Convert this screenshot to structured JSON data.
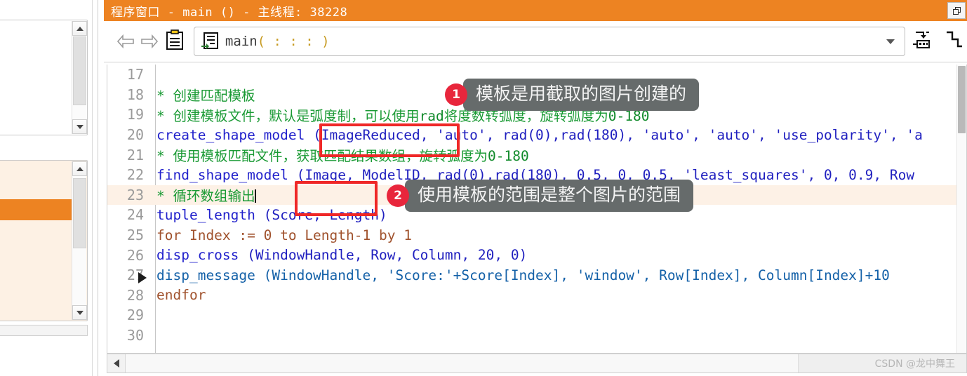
{
  "window": {
    "title": "程序窗口 - main () - 主线程: 38228",
    "restore_label": "restore-window"
  },
  "toolbar": {
    "back_label": "back",
    "forward_label": "forward",
    "clipboard_label": "clipboard",
    "procedure_name": "main",
    "procedure_params": "( : : : )",
    "dropdown_label": "procedure-selector",
    "icon1_label": "insert-breakpoint",
    "icon2_label": "step-over"
  },
  "editor": {
    "lines": [
      {
        "num": "17",
        "highlight": false,
        "segments": []
      },
      {
        "num": "18",
        "highlight": false,
        "segments": [
          {
            "cls": "cm",
            "text": "* 创建匹配模板"
          }
        ]
      },
      {
        "num": "19",
        "highlight": false,
        "segments": [
          {
            "cls": "cm",
            "text": "* 创建模板文件，默认是弧度制，可以使用"
          },
          {
            "cls": "cm2",
            "text": "rad"
          },
          {
            "cls": "cm",
            "text": "将度数转弧度，旋转弧度为"
          },
          {
            "cls": "cm2",
            "text": "0-180"
          }
        ]
      },
      {
        "num": "20",
        "highlight": false,
        "segments": [
          {
            "cls": "fn",
            "text": "create_shape_model"
          },
          {
            "cls": "pn",
            "text": " (ImageReduced, 'auto', rad(0),rad(180), 'auto', 'auto', 'use_polarity', 'a"
          }
        ]
      },
      {
        "num": "21",
        "highlight": false,
        "segments": [
          {
            "cls": "cm",
            "text": "* 使用模板匹配文件，获取匹配结果数组，旋转弧度为"
          },
          {
            "cls": "cm2",
            "text": "0-180"
          }
        ]
      },
      {
        "num": "22",
        "highlight": false,
        "segments": [
          {
            "cls": "fn",
            "text": "find_shape_model"
          },
          {
            "cls": "pn",
            "text": " (Image, ModelID, rad(0),rad(180), 0.5, 0, 0.5, 'least_squares', 0, 0.9, Row"
          }
        ]
      },
      {
        "num": "23",
        "highlight": true,
        "segments": [
          {
            "cls": "cm",
            "text": "* 循环数组输出"
          },
          {
            "cls": "caret",
            "text": ""
          }
        ]
      },
      {
        "num": "24",
        "highlight": false,
        "segments": [
          {
            "cls": "fn",
            "text": "tuple_length"
          },
          {
            "cls": "pn",
            "text": " (Score, Length)"
          }
        ]
      },
      {
        "num": "25",
        "highlight": false,
        "segments": [
          {
            "cls": "kw",
            "text": "for Index := 0 to Length-1 by 1"
          }
        ]
      },
      {
        "num": "26",
        "highlight": false,
        "segments": [
          {
            "cls": "fn",
            "text": "    disp_cross"
          },
          {
            "cls": "pn",
            "text": " (WindowHandle, Row, Column, 20, 0)"
          }
        ]
      },
      {
        "num": "27",
        "highlight": false,
        "segments": [
          {
            "cls": "id",
            "text": "    disp_message (WindowHandle, 'Score:'+Score[Index], 'window', Row[Index], Column[Index]+10"
          }
        ]
      },
      {
        "num": "28",
        "highlight": false,
        "segments": [
          {
            "cls": "kw",
            "text": "endfor"
          }
        ]
      },
      {
        "num": "29",
        "highlight": false,
        "segments": []
      },
      {
        "num": "30",
        "highlight": false,
        "segments": []
      }
    ]
  },
  "annotations": {
    "callout1": {
      "number": "1",
      "text": "模板是用截取的图片创建的"
    },
    "callout2": {
      "number": "2",
      "text": "使用模板的范围是整个图片的范围"
    },
    "box1_label": "highlight-image-reduced",
    "box2_label": "highlight-image"
  },
  "statusbar": {
    "watermark": "CSDN @龙中舞王",
    "scroll_left_label": "scroll-left"
  },
  "colors": {
    "accent": "#ed8322",
    "annotation_red": "#ef2828",
    "badge_red": "#e8263c",
    "bubble_gray": "#666b6b",
    "comment_green": "#1a9a34",
    "code_blue": "#2222cc",
    "keyword_brown": "#a0522d"
  }
}
